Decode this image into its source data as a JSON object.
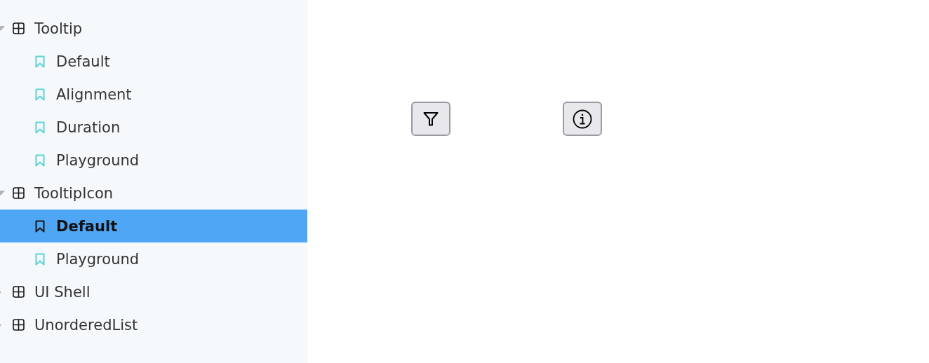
{
  "sidebar": {
    "items": [
      {
        "label": "Tooltip",
        "expanded": true,
        "children": [
          {
            "label": "Default",
            "selected": false
          },
          {
            "label": "Alignment",
            "selected": false
          },
          {
            "label": "Duration",
            "selected": false
          },
          {
            "label": "Playground",
            "selected": false
          }
        ]
      },
      {
        "label": "TooltipIcon",
        "expanded": true,
        "children": [
          {
            "label": "Default",
            "selected": true
          },
          {
            "label": "Playground",
            "selected": false
          }
        ]
      },
      {
        "label": "UI Shell",
        "expanded": false
      },
      {
        "label": "UnorderedList",
        "expanded": false
      }
    ]
  },
  "canvas": {
    "buttons": [
      {
        "kind": "filter"
      },
      {
        "kind": "info"
      }
    ]
  }
}
